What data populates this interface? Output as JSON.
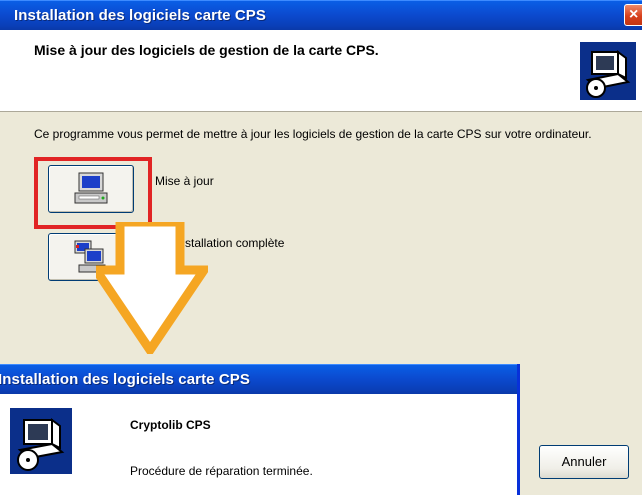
{
  "back_window": {
    "title": "Installation des logiciels carte CPS",
    "close_glyph": "×",
    "header_title": "Mise à jour des logiciels de gestion de la carte CPS.",
    "header_icon": "computer-cd-icon",
    "description": "Ce programme vous permet de mettre à jour les logiciels de gestion de la carte CPS sur votre ordinateur.",
    "options": [
      {
        "label": "Mise à jour",
        "icon": "update-computer-icon"
      },
      {
        "label": "Installation complète",
        "icon": "network-computers-icon"
      }
    ],
    "cancel_label": "Annuler",
    "highlight_color": "#e12424",
    "arrow_color": "#f5a623"
  },
  "front_window": {
    "title": "Installation des logiciels carte CPS",
    "product": "Cryptolib CPS",
    "message": "Procédure de réparation terminée.",
    "icon": "computer-cd-icon"
  }
}
